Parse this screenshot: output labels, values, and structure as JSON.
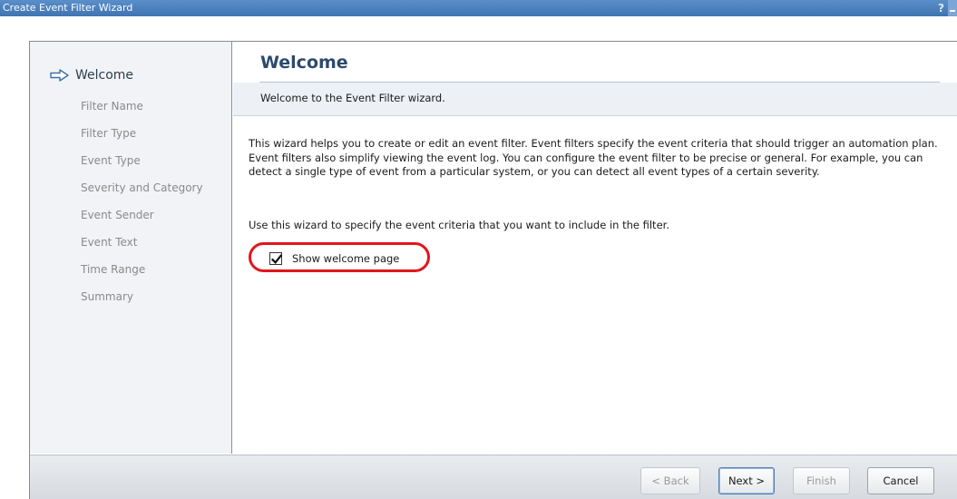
{
  "window": {
    "title": "Create Event Filter Wizard",
    "help_glyph": "?"
  },
  "sidebar": {
    "steps": [
      {
        "label": "Welcome",
        "state": "active"
      },
      {
        "label": "Filter Name",
        "state": "pending"
      },
      {
        "label": "Filter Type",
        "state": "pending"
      },
      {
        "label": "Event Type",
        "state": "pending"
      },
      {
        "label": "Severity and Category",
        "state": "pending"
      },
      {
        "label": "Event Sender",
        "state": "pending"
      },
      {
        "label": "Event Text",
        "state": "pending"
      },
      {
        "label": "Time Range",
        "state": "pending"
      },
      {
        "label": "Summary",
        "state": "pending"
      }
    ],
    "active_icon": "arrow-right-icon"
  },
  "page": {
    "title": "Welcome",
    "subtitle": "Welcome to the Event Filter wizard.",
    "description": "This wizard helps you to create or edit an event filter. Event filters specify the event criteria that should trigger an automation plan. Event filters also simplify viewing the event log. You can configure the event filter to be precise or general. For example, you can detect a single type of event from a particular system, or you can detect all event types of a certain severity.",
    "instruction": "Use this wizard to specify the event criteria that you want to include in the filter.",
    "checkbox": {
      "label": "Show welcome page",
      "checked": true
    }
  },
  "buttons": {
    "back": "< Back",
    "next": "Next >",
    "finish": "Finish",
    "cancel": "Cancel"
  },
  "colors": {
    "titlebar": "#4a80bf",
    "highlight": "#e0161c",
    "accent": "#2c4a6b"
  }
}
